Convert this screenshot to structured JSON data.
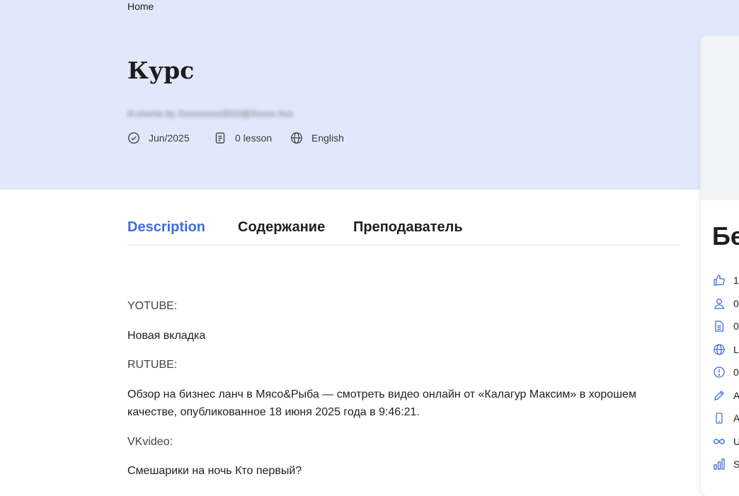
{
  "breadcrumb": {
    "home": "Home"
  },
  "course": {
    "title": "Курс",
    "author": "A course by Xxxxxxxxx2010@Xxxxx.Xxx",
    "meta": {
      "date": "Jun/2025",
      "lessons": "0 lesson",
      "language": "English"
    }
  },
  "tabs": {
    "description": "Description",
    "content": "Содержание",
    "instructor": "Преподаватель"
  },
  "description": {
    "youtube_label": "YOTUBE:",
    "youtube_text": "Новая вкладка",
    "rutube_label": "RUTUBE:",
    "rutube_text_line1": "Обзор на бизнес ланч в Мясо&Рыба — смотреть видео онлайн от «Калагур Максим» в хорошем",
    "rutube_text_line2": "качестве, опубликованное 18 июня 2025 года в 9:46:21.",
    "vk_label": "VKvideo:",
    "vk_text": "Смешарики на ночь Кто первый?"
  },
  "sidebar": {
    "price": "Бе",
    "rows": [
      {
        "icon": "thumbs-up-icon",
        "text": "1("
      },
      {
        "icon": "user-icon",
        "text": "0"
      },
      {
        "icon": "document-icon",
        "text": "0"
      },
      {
        "icon": "globe-icon",
        "text": "L"
      },
      {
        "icon": "info-circle-icon",
        "text": "0"
      },
      {
        "icon": "pencil-icon",
        "text": "A"
      },
      {
        "icon": "mobile-icon",
        "text": "A"
      },
      {
        "icon": "infinity-icon",
        "text": "U"
      },
      {
        "icon": "bar-chart-icon",
        "text": "S"
      }
    ]
  },
  "colors": {
    "hero_background": "#e1e8fb",
    "accent": "#3d6fd6",
    "icon_blue": "#3d6fd6"
  }
}
